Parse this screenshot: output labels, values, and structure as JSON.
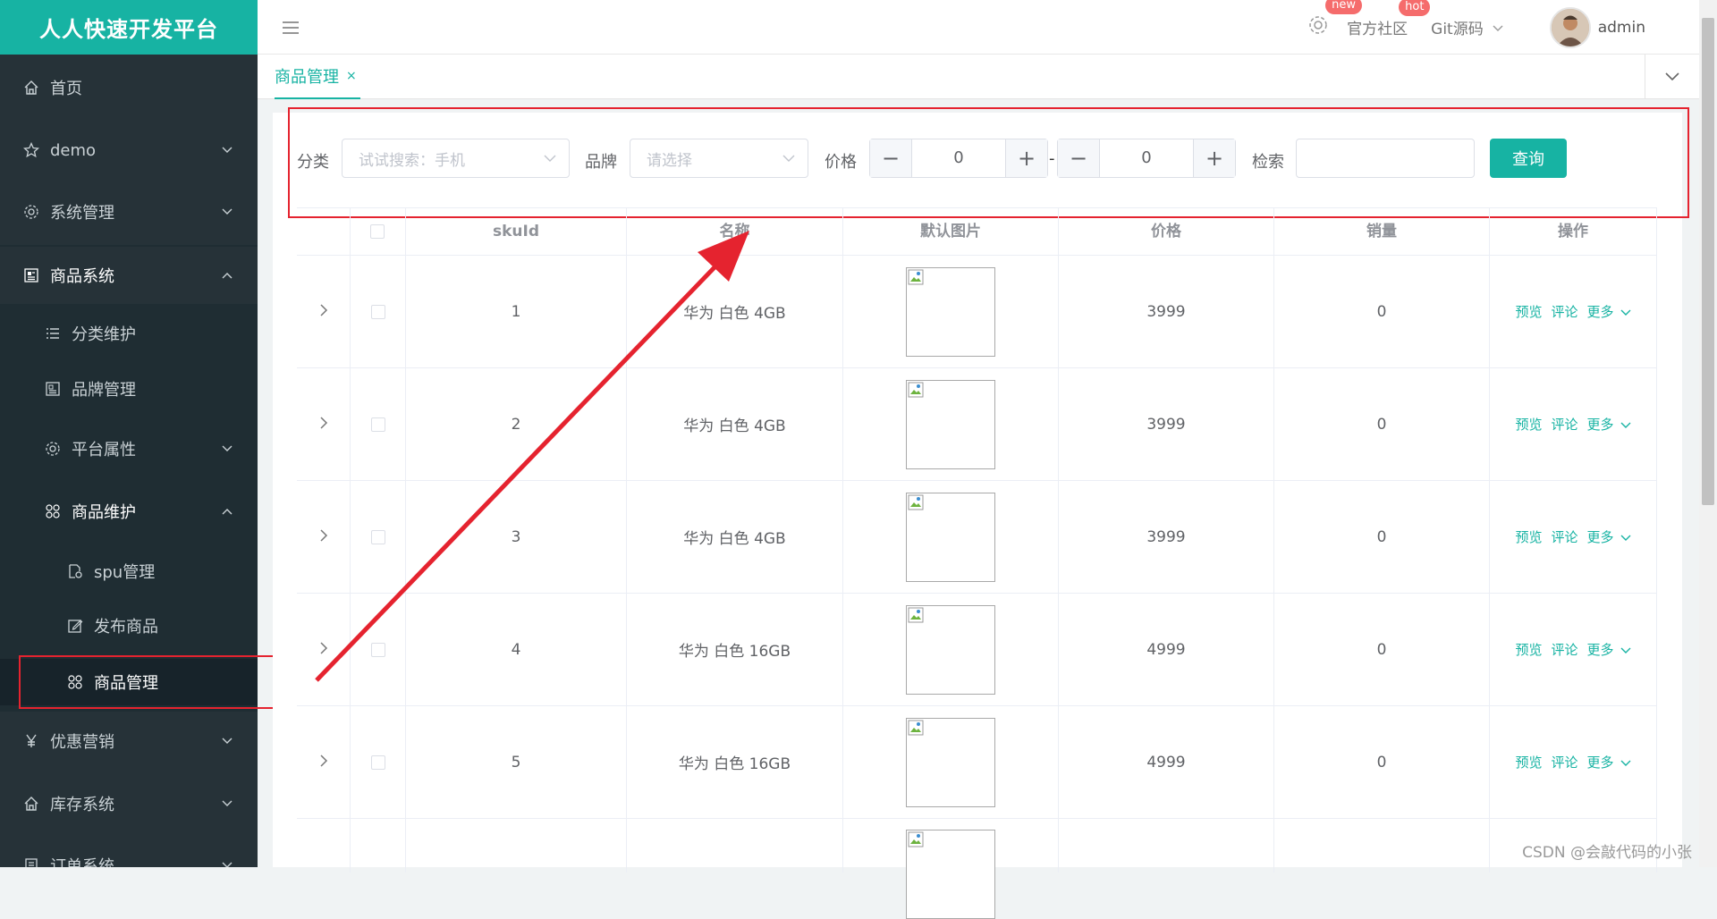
{
  "sidebar": {
    "brand": "人人快速开发平台",
    "items": [
      {
        "label": "首页",
        "icon": "home-icon"
      },
      {
        "label": "demo",
        "icon": "star-icon"
      },
      {
        "label": "系统管理",
        "icon": "gear-icon"
      },
      {
        "label": "商品系统",
        "icon": "product-icon"
      },
      {
        "label": "分类维护",
        "icon": "list-icon"
      },
      {
        "label": "品牌管理",
        "icon": "brand-icon"
      },
      {
        "label": "平台属性",
        "icon": "gear-icon"
      },
      {
        "label": "商品维护",
        "icon": "grid-icon"
      },
      {
        "label": "spu管理",
        "icon": "doc-gear-icon"
      },
      {
        "label": "发布商品",
        "icon": "edit-icon"
      },
      {
        "label": "商品管理",
        "icon": "grid-icon"
      },
      {
        "label": "优惠营销",
        "icon": "yen-icon"
      },
      {
        "label": "库存系统",
        "icon": "home-icon"
      },
      {
        "label": "订单系统",
        "icon": "order-icon"
      }
    ]
  },
  "navbar": {
    "badge_new": "new",
    "community": "官方社区",
    "badge_hot": "hot",
    "git": "Git源码",
    "user": "admin"
  },
  "tabs": {
    "active": "商品管理",
    "close": "×"
  },
  "search": {
    "category_label": "分类",
    "category_placeholder": "试试搜索：手机",
    "brand_label": "品牌",
    "brand_placeholder": "请选择",
    "price_label": "价格",
    "price_min": "0",
    "price_max": "0",
    "dash": "-",
    "keyword_label": "检索",
    "keyword_value": "",
    "query_button": "查询"
  },
  "table": {
    "headers": [
      "skuId",
      "名称",
      "默认图片",
      "价格",
      "销量",
      "操作"
    ],
    "rows": [
      {
        "skuId": "1",
        "name": "华为 白色 4GB",
        "price": "3999",
        "sales": "0"
      },
      {
        "skuId": "2",
        "name": "华为 白色 4GB",
        "price": "3999",
        "sales": "0"
      },
      {
        "skuId": "3",
        "name": "华为 白色 4GB",
        "price": "3999",
        "sales": "0"
      },
      {
        "skuId": "4",
        "name": "华为 白色 16GB",
        "price": "4999",
        "sales": "0"
      },
      {
        "skuId": "5",
        "name": "华为 白色 16GB",
        "price": "4999",
        "sales": "0"
      }
    ],
    "op_preview": "预览",
    "op_comment": "评论",
    "op_more": "更多"
  },
  "watermark": "CSDN @会敲代码的小张",
  "colors": {
    "accent": "#17b3a3",
    "sidebar_bg": "#263238",
    "annotation_red": "#e5232f"
  }
}
